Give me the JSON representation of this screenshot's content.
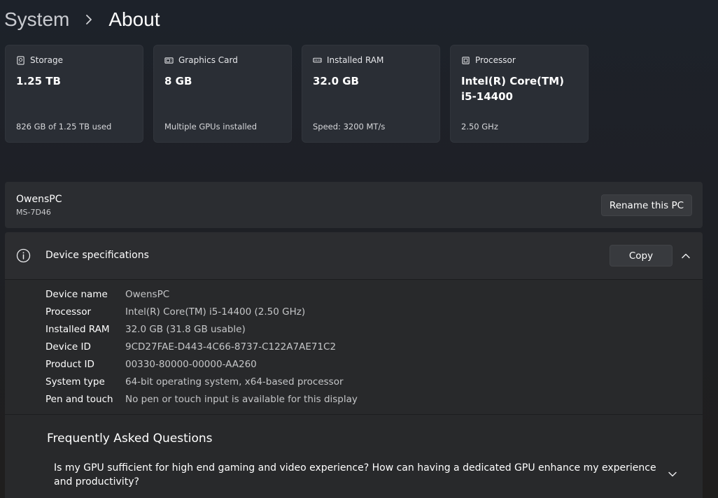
{
  "breadcrumb": {
    "parent": "System",
    "current": "About"
  },
  "cards": [
    {
      "icon": "storage-icon",
      "label": "Storage",
      "value": "1.25 TB",
      "sub": "826 GB of 1.25 TB used"
    },
    {
      "icon": "graphics-card-icon",
      "label": "Graphics Card",
      "value": "8 GB",
      "sub": "Multiple GPUs installed"
    },
    {
      "icon": "ram-icon",
      "label": "Installed RAM",
      "value": "32.0 GB",
      "sub": "Speed: 3200 MT/s"
    },
    {
      "icon": "processor-icon",
      "label": "Processor",
      "value": "Intel(R) Core(TM) i5-14400",
      "sub": "2.50 GHz"
    }
  ],
  "pc": {
    "name": "OwensPC",
    "model": "MS-7D46",
    "rename_label": "Rename this PC"
  },
  "specs": {
    "title": "Device specifications",
    "copy_label": "Copy",
    "rows": [
      {
        "label": "Device name",
        "value": "OwensPC"
      },
      {
        "label": "Processor",
        "value": "Intel(R) Core(TM) i5-14400 (2.50 GHz)"
      },
      {
        "label": "Installed RAM",
        "value": "32.0 GB (31.8 GB usable)"
      },
      {
        "label": "Device ID",
        "value": "9CD27FAE-D443-4C66-8737-C122A7AE71C2"
      },
      {
        "label": "Product ID",
        "value": "00330-80000-00000-AA260"
      },
      {
        "label": "System type",
        "value": "64-bit operating system, x64-based processor"
      },
      {
        "label": "Pen and touch",
        "value": "No pen or touch input is available for this display"
      }
    ]
  },
  "faq": {
    "title": "Frequently Asked Questions",
    "question": "Is my GPU sufficient for high end gaming and video experience? How can having a dedicated GPU enhance my experience and productivity?"
  }
}
